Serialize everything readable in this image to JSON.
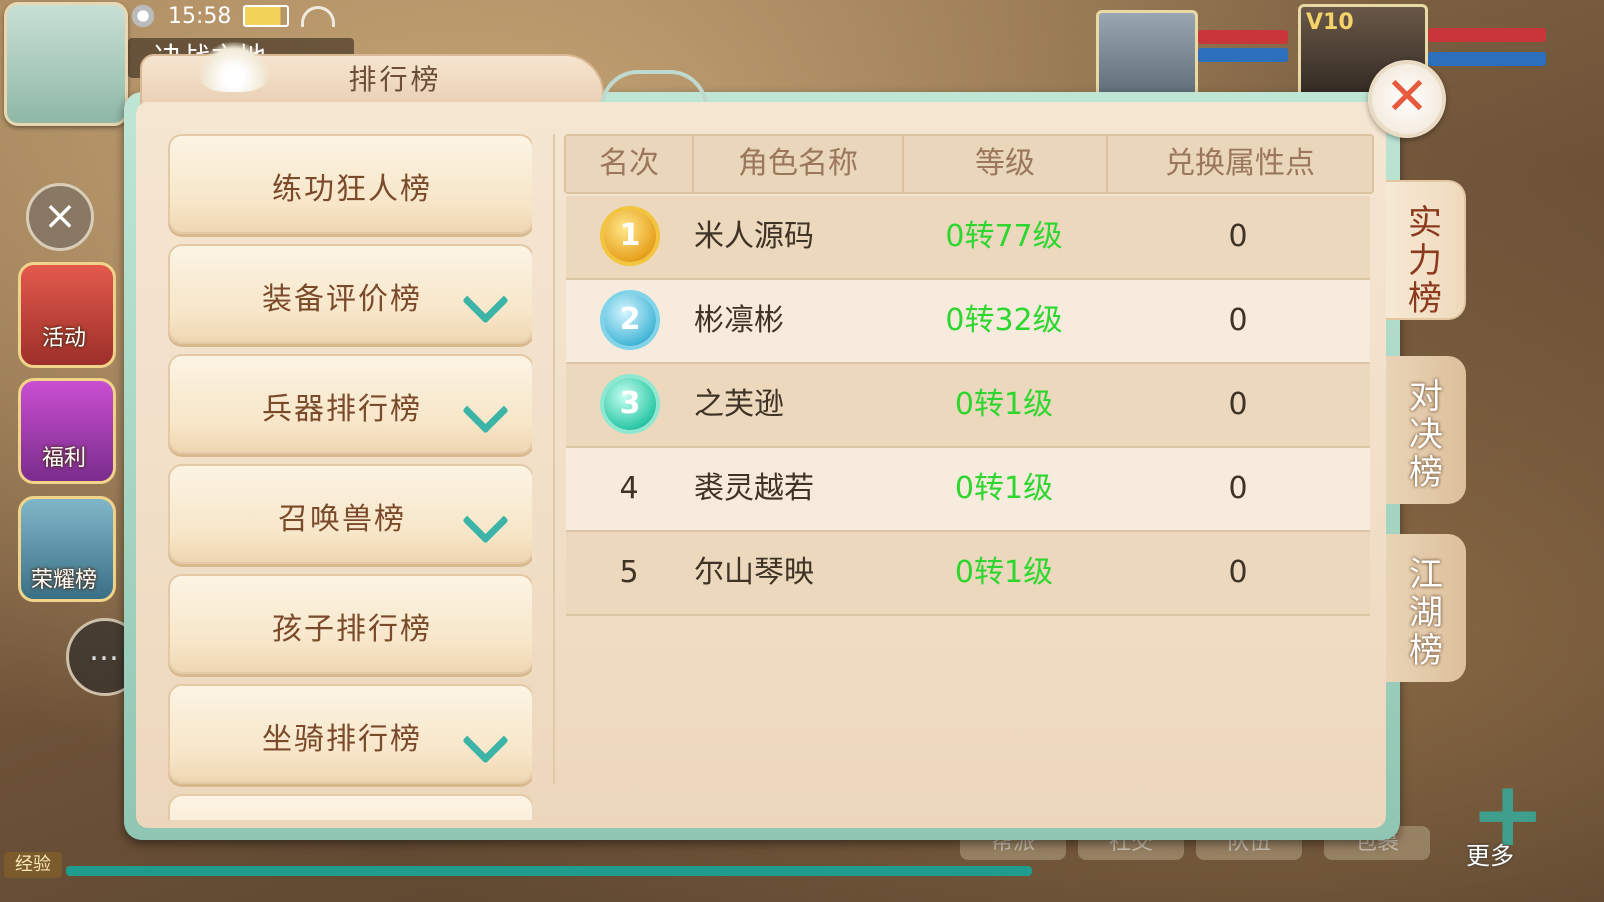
{
  "hud": {
    "time": "15:58",
    "scene_name": "决战之地",
    "side_buttons": [
      "活动",
      "福利",
      "荣耀榜"
    ],
    "vip_label": "V10",
    "exp_label": "经验",
    "bottom_buttons": [
      "帮派",
      "社交",
      "队伍",
      "包裹"
    ],
    "more_label": "更多"
  },
  "panel": {
    "title": "排行榜",
    "close_symbol": "✕",
    "categories": [
      {
        "label": "练功狂人榜",
        "expandable": false
      },
      {
        "label": "装备评价榜",
        "expandable": true
      },
      {
        "label": "兵器排行榜",
        "expandable": true
      },
      {
        "label": "召唤兽榜",
        "expandable": true
      },
      {
        "label": "孩子排行榜",
        "expandable": false
      },
      {
        "label": "坐骑排行榜",
        "expandable": true
      }
    ],
    "table": {
      "headers": [
        "名次",
        "角色名称",
        "等级",
        "兑换属性点"
      ],
      "rows": [
        {
          "rank": "1",
          "name": "米人源码",
          "level": "0转77级",
          "points": "0"
        },
        {
          "rank": "2",
          "name": "彬凛彬",
          "level": "0转32级",
          "points": "0"
        },
        {
          "rank": "3",
          "name": "之芙逊",
          "level": "0转1级",
          "points": "0"
        },
        {
          "rank": "4",
          "name": "裘灵越若",
          "level": "0转1级",
          "points": "0"
        },
        {
          "rank": "5",
          "name": "尔山琴映",
          "level": "0转1级",
          "points": "0"
        }
      ]
    },
    "side_tabs": [
      {
        "label": "实力榜",
        "active": true
      },
      {
        "label": "对决榜",
        "active": false
      },
      {
        "label": "江湖榜",
        "active": false
      }
    ]
  },
  "colors": {
    "level_text": "#2fd62f",
    "close_x": "#e65a3e",
    "chevron": "#3cb4a8",
    "title_text": "#6a4e37"
  }
}
